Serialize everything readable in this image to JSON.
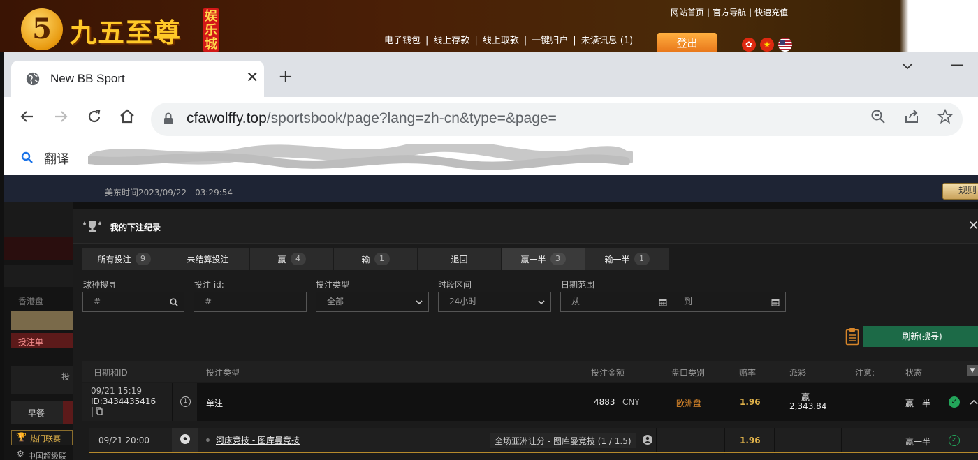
{
  "site": {
    "logo_char": "5",
    "logo_text": "九五至尊",
    "logo_tag": "娱乐城",
    "top_links": [
      "网站首页",
      "官方导航",
      "快速充值"
    ],
    "nav_links": [
      "电子钱包",
      "线上存款",
      "线上取款",
      "一键归户",
      "未读讯息 (1)"
    ],
    "logout": "登出"
  },
  "browser": {
    "tab_title": "New BB Sport",
    "url_host": "cfawolffy.top",
    "url_path": "/sportsbook/page?lang=zh-cn&type=&page=",
    "bookmark_label": "翻译"
  },
  "sportsbook": {
    "clock": "美东时间2023/09/22 - 03:29:54",
    "rules": "规则",
    "left_panel": {
      "hk_odds": "香港盘",
      "bet_slip": "投注单",
      "bet_label": "投",
      "early": "早餐",
      "hot_league": "热门联赛",
      "cn_league": "中国超级联"
    },
    "modal": {
      "title": "我的下注纪录",
      "tabs": [
        {
          "label": "所有投注",
          "count": "9"
        },
        {
          "label": "未结算投注",
          "count": ""
        },
        {
          "label": "赢",
          "count": "4"
        },
        {
          "label": "输",
          "count": "1"
        },
        {
          "label": "退回",
          "count": ""
        },
        {
          "label": "赢一半",
          "count": "3"
        },
        {
          "label": "输一半",
          "count": "1"
        }
      ],
      "filters": {
        "sport_label": "球种搜寻",
        "sport_placeholder": "#",
        "betid_label": "投注 id:",
        "betid_placeholder": "#",
        "bettype_label": "投注类型",
        "bettype_value": "全部",
        "period_label": "时段区间",
        "period_value": "24小时",
        "date_label": "日期范围",
        "date_from": "从",
        "date_to": "到"
      },
      "refresh_button": "刷新(搜寻)",
      "columns": {
        "date_id": "日期和ID",
        "bet_type": "投注类型",
        "amount": "投注金额",
        "market": "盘口类别",
        "odds": "赔率",
        "payout": "派彩",
        "note": "注意:",
        "status": "状态"
      },
      "bet": {
        "date": "09/21 15:19",
        "id": "ID:3434435416",
        "legs": "1",
        "type": "单注",
        "amount": "4883",
        "currency": "CNY",
        "market": "欧洲盘",
        "odds": "1.96",
        "payout_label": "赢",
        "payout_value": "2,343.84",
        "status": "赢一半"
      },
      "leg": {
        "date": "09/21 20:00",
        "match": "河床竞技 - 图库曼竞技",
        "selection": "全场亚洲让分 - 图库曼竞技 (1 / 1.5)",
        "odds": "1.96",
        "status": "赢一半"
      }
    }
  },
  "colors": {
    "accent_orange": "#e8761a",
    "refresh_green": "#1c6a47",
    "odds_gold": "#e0b24a",
    "market_orange": "#d8862a",
    "win_green": "#23a55a"
  }
}
